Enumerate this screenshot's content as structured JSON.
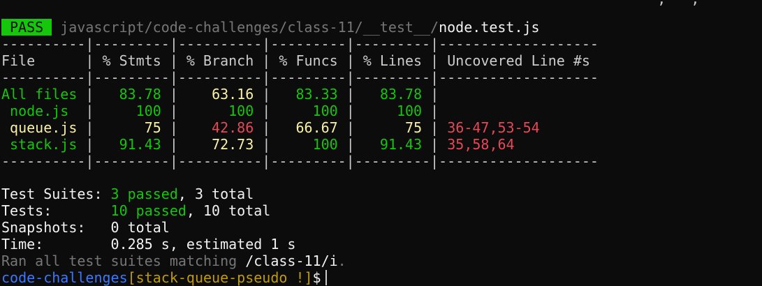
{
  "top_fragment": "                                                                              ,   ,    ",
  "header": {
    "badge": "PASS",
    "path_dir": "javascript/code-challenges/class-11/__test__/",
    "path_file": "node.test.js"
  },
  "table": {
    "separator": "----------|---------|----------|---------|---------|-------------------",
    "columns": [
      "File",
      "% Stmts",
      "% Branch",
      "% Funcs",
      "% Lines",
      "Uncovered Line #s"
    ],
    "rows": [
      {
        "file": "All files",
        "stmts": "83.78",
        "branch": "63.16",
        "funcs": "83.33",
        "lines": "83.78",
        "uncovered": ""
      },
      {
        "file": " node.js",
        "stmts": "100",
        "branch": "100",
        "funcs": "100",
        "lines": "100",
        "uncovered": ""
      },
      {
        "file": " queue.js",
        "stmts": "75",
        "branch": "42.86",
        "funcs": "66.67",
        "lines": "75",
        "uncovered": "36-47,53-54"
      },
      {
        "file": " stack.js",
        "stmts": "91.43",
        "branch": "72.73",
        "funcs": "100",
        "lines": "91.43",
        "uncovered": "35,58,64"
      }
    ]
  },
  "summary": {
    "suites_label": "Test Suites:",
    "suites_passed": "3 passed",
    "suites_total": ", 3 total",
    "tests_label": "Tests:",
    "tests_passed": "10 passed",
    "tests_total": ", 10 total",
    "snapshots_label": "Snapshots:",
    "snapshots_value": "0 total",
    "time_label": "Time:",
    "time_value": "0.285 s, estimated 1 s",
    "ran_text": "Ran all test suites matching ",
    "ran_pattern": "/class-11/i",
    "ran_end": "."
  },
  "prompt": {
    "dir": "code-challenges",
    "branch": "[stack-queue-pseudo !]",
    "symbol": "$"
  }
}
